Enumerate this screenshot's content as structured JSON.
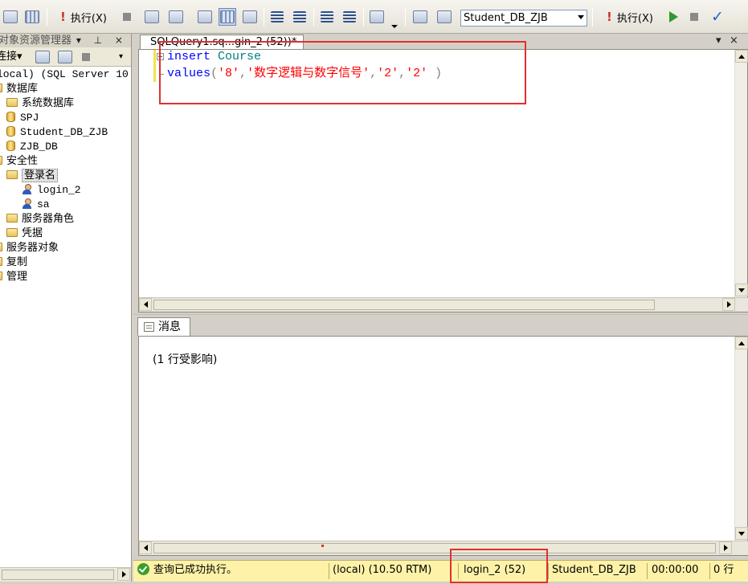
{
  "toolbar": {
    "execute_label": "执行(X)",
    "execute_label_2": "执行(X)",
    "database_selected": "Student_DB_ZJB",
    "icons": [
      "query-icon",
      "results-grid-icon",
      "comment-icon",
      "indent-icon",
      "specify-values-icon",
      "execute-icon",
      "parse-icon",
      "debug-icon"
    ]
  },
  "explorer": {
    "title": "对象资源管理器",
    "title_controls": "▾ ⊥ ×",
    "connect_label": "连接",
    "tree": [
      {
        "label": "local) (SQL Server 10",
        "type": "server"
      },
      {
        "label": "数据库",
        "type": "folder"
      },
      {
        "label": "系统数据库",
        "type": "folder"
      },
      {
        "label": "SPJ",
        "type": "db"
      },
      {
        "label": "Student_DB_ZJB",
        "type": "db"
      },
      {
        "label": "ZJB_DB",
        "type": "db"
      },
      {
        "label": "安全性",
        "type": "folder"
      },
      {
        "label": "登录名",
        "type": "folder"
      },
      {
        "label": "login_2",
        "type": "user"
      },
      {
        "label": "sa",
        "type": "user"
      },
      {
        "label": "服务器角色",
        "type": "folder"
      },
      {
        "label": "凭据",
        "type": "folder"
      },
      {
        "label": "服务器对象",
        "type": "folder"
      },
      {
        "label": "复制",
        "type": "folder"
      },
      {
        "label": "管理",
        "type": "folder"
      }
    ]
  },
  "editor": {
    "tab_label": "SQLQuery1.sq...gin_2 (52))*",
    "line1_kw": "insert",
    "line1_ident": "Course",
    "line2_kw": "values",
    "line2_open": "(",
    "line2_s1": "'8'",
    "line2_c1": ",",
    "line2_s2": "'数字逻辑与数字信号'",
    "line2_c2": ",",
    "line2_s3": "'2'",
    "line2_c3": ",",
    "line2_s4": "'2'",
    "line2_close": " )"
  },
  "results": {
    "tab_label": "消息",
    "message": "(1 行受影响)"
  },
  "statusbar": {
    "status": "查询已成功执行。",
    "server": "(local) (10.50 RTM)",
    "login": "login_2 (52)",
    "database": "Student_DB_ZJB",
    "elapsed": "00:00:00",
    "rows": "0 行"
  }
}
